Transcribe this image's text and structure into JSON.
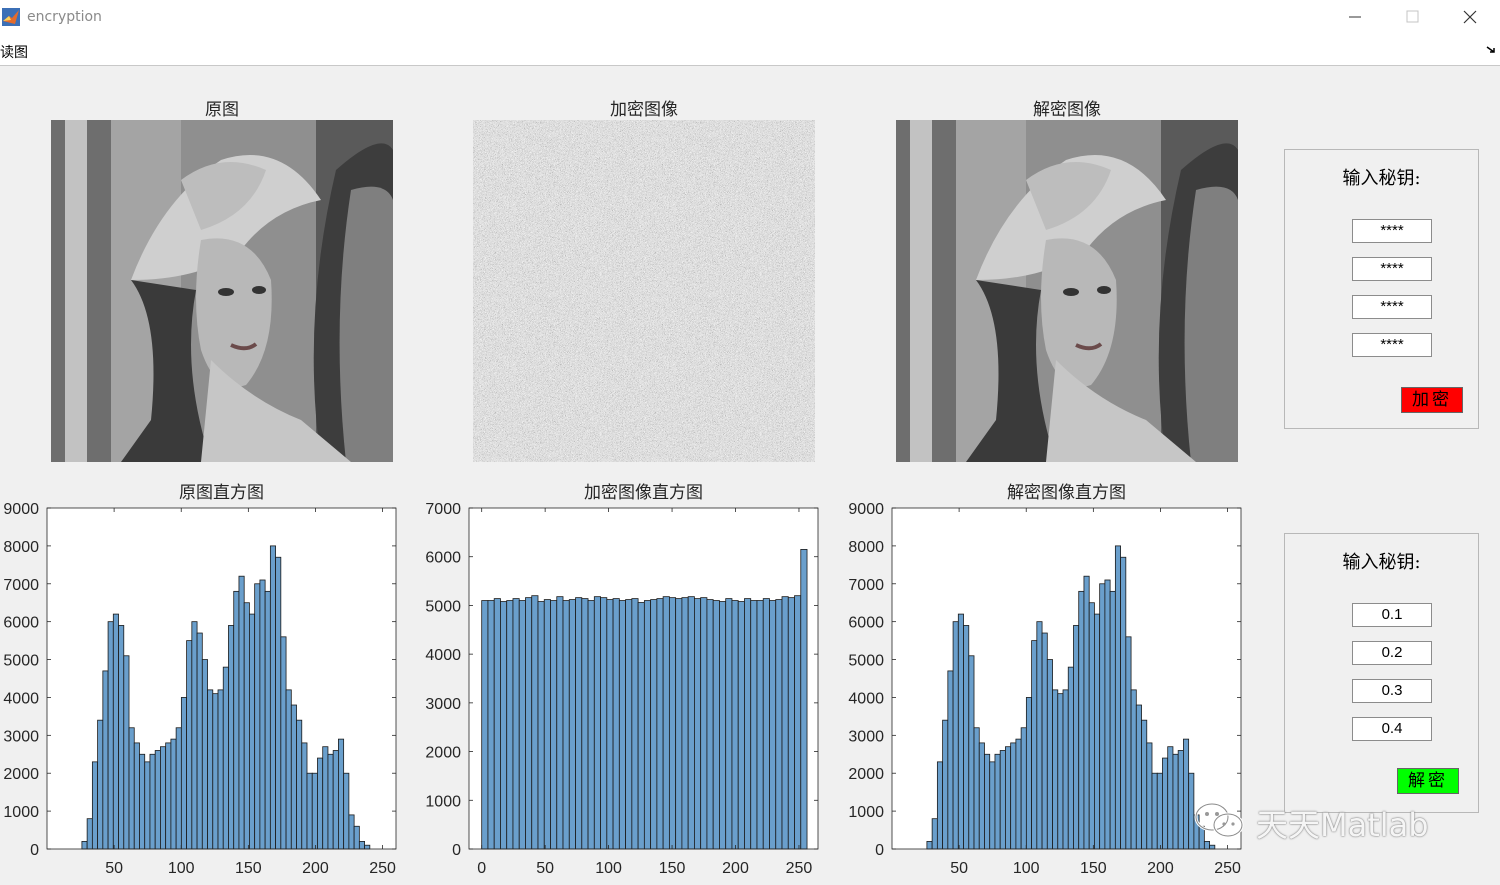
{
  "window": {
    "title": "encryption"
  },
  "menu": {
    "items": [
      "读图"
    ]
  },
  "panels": {
    "original": {
      "title": "原图"
    },
    "encrypted": {
      "title": "加密图像"
    },
    "decrypted": {
      "title": "解密图像"
    }
  },
  "encrypt_panel": {
    "title": "输入秘钥:",
    "fields": [
      "****",
      "****",
      "****",
      "****"
    ],
    "button_label": "加密",
    "button_color": "#ff0000"
  },
  "decrypt_panel": {
    "title": "输入秘钥:",
    "fields": [
      "0.1",
      "0.2",
      "0.3",
      "0.4"
    ],
    "button_label": "解密",
    "button_color": "#00ff00"
  },
  "watermark": {
    "text": "天天Matlab"
  },
  "chart_data": [
    {
      "type": "bar",
      "title": "原图直方图",
      "xlim": [
        0,
        260
      ],
      "ylim": [
        0,
        9000
      ],
      "xticks": [
        50,
        100,
        150,
        200,
        250
      ],
      "yticks": [
        0,
        1000,
        2000,
        3000,
        4000,
        5000,
        6000,
        7000,
        8000,
        9000
      ],
      "bar_color": "#6a9fcc",
      "bins_start": 26,
      "bin_width": 3.9,
      "values": [
        200,
        800,
        2300,
        3400,
        4700,
        6000,
        6200,
        5900,
        5100,
        3200,
        2800,
        2500,
        2300,
        2500,
        2600,
        2700,
        2800,
        2900,
        3200,
        4000,
        5500,
        6000,
        5700,
        5000,
        4200,
        4100,
        4200,
        4800,
        5900,
        6800,
        7200,
        6500,
        6200,
        7000,
        7100,
        6800,
        8000,
        7700,
        5600,
        4200,
        3800,
        3400,
        2800,
        2000,
        2000,
        2400,
        2700,
        2500,
        2600,
        2900,
        2000,
        900,
        600,
        200,
        100
      ]
    },
    {
      "type": "bar",
      "title": "加密图像直方图",
      "xlim": [
        -10,
        265
      ],
      "ylim": [
        0,
        7000
      ],
      "xticks": [
        0,
        50,
        100,
        150,
        200,
        250
      ],
      "yticks": [
        0,
        1000,
        2000,
        3000,
        4000,
        5000,
        6000,
        7000
      ],
      "bar_color": "#6a9fcc",
      "bins_start": 0,
      "bin_width": 4.93,
      "values": [
        5100,
        5100,
        5140,
        5080,
        5100,
        5140,
        5100,
        5160,
        5200,
        5080,
        5120,
        5100,
        5180,
        5100,
        5120,
        5160,
        5140,
        5100,
        5180,
        5160,
        5120,
        5140,
        5100,
        5120,
        5140,
        5060,
        5100,
        5120,
        5140,
        5180,
        5160,
        5140,
        5160,
        5180,
        5140,
        5160,
        5120,
        5100,
        5080,
        5140,
        5100,
        5080,
        5140,
        5100,
        5100,
        5140,
        5100,
        5120,
        5180,
        5160,
        5200,
        6150
      ]
    },
    {
      "type": "bar",
      "title": "解密图像直方图",
      "xlim": [
        0,
        260
      ],
      "ylim": [
        0,
        9000
      ],
      "xticks": [
        50,
        100,
        150,
        200,
        250
      ],
      "yticks": [
        0,
        1000,
        2000,
        3000,
        4000,
        5000,
        6000,
        7000,
        8000,
        9000
      ],
      "bar_color": "#6a9fcc",
      "bins_start": 26,
      "bin_width": 3.9,
      "values": [
        200,
        800,
        2300,
        3400,
        4700,
        6000,
        6200,
        5900,
        5100,
        3200,
        2800,
        2500,
        2300,
        2500,
        2600,
        2700,
        2800,
        2900,
        3200,
        4000,
        5500,
        6000,
        5700,
        5000,
        4200,
        4100,
        4200,
        4800,
        5900,
        6800,
        7200,
        6500,
        6200,
        7000,
        7100,
        6800,
        8000,
        7700,
        5600,
        4200,
        3800,
        3400,
        2800,
        2000,
        2000,
        2400,
        2700,
        2500,
        2600,
        2900,
        2000,
        900,
        600,
        200,
        100
      ]
    }
  ]
}
